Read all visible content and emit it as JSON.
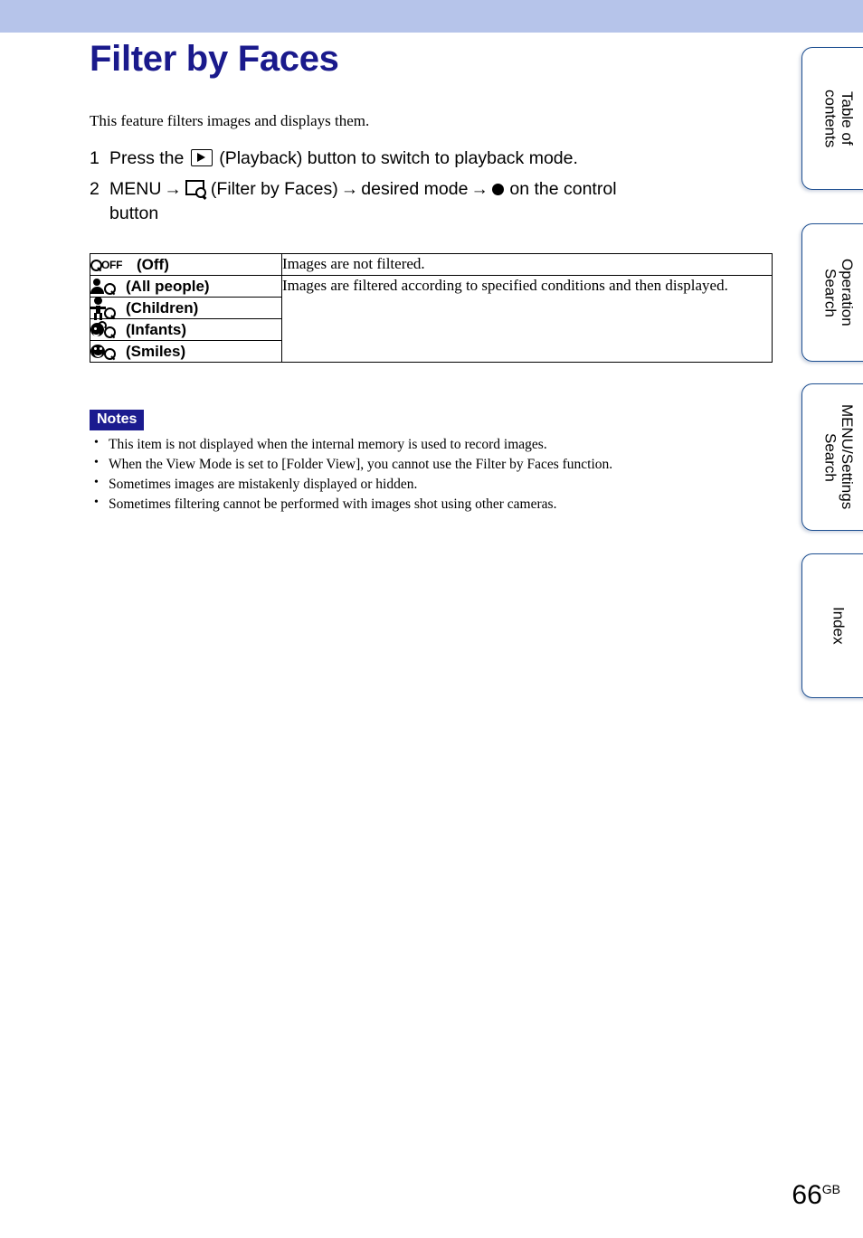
{
  "document": {
    "title": "Filter by Faces",
    "intro": "This feature filters images and displays them.",
    "page_number": "66",
    "page_suffix": "GB",
    "title_color": "#1a1a8c",
    "band_color": "#b6c4ea"
  },
  "steps": [
    {
      "number": "1",
      "before_icon": "Press the",
      "icon": "playback-icon",
      "after_icon": "(Playback) button to switch to playback mode."
    },
    {
      "number": "2",
      "menu_label": "MENU",
      "arrow1": "→",
      "icon": "filter-by-faces-icon",
      "icon_caption": "(Filter by Faces)",
      "arrow2": "→",
      "desired_mode": "desired mode",
      "arrow3": "→",
      "control_dot": "●",
      "tail": "on the control",
      "tail_line2": "button"
    }
  ],
  "table": {
    "rows": [
      {
        "icon": "magnifier-off-icon",
        "label": "(Off)"
      },
      {
        "icon": "all-people-icon",
        "label": "(All people)"
      },
      {
        "icon": "children-icon",
        "label": "(Children)"
      },
      {
        "icon": "infants-icon",
        "label": "(Infants)"
      },
      {
        "icon": "smiles-icon",
        "label": "(Smiles)"
      }
    ],
    "descriptions": {
      "off": "Images are not filtered.",
      "filtered": "Images are filtered according to specified conditions and then displayed."
    }
  },
  "notes": {
    "badge": "Notes",
    "items": [
      "This item is not displayed when the internal memory is used to record images.",
      "When the View Mode is set to [Folder View], you cannot use the Filter by Faces function.",
      "Sometimes images are mistakenly displayed or hidden.",
      "Sometimes filtering cannot be performed with images shot using other cameras."
    ]
  },
  "tabs": [
    {
      "label": "Table of\ncontents"
    },
    {
      "label": "Operation\nSearch"
    },
    {
      "label": "MENU/Settings\nSearch"
    },
    {
      "label": "Index"
    }
  ],
  "icon_glyphs": {
    "off_text": "OFF"
  }
}
